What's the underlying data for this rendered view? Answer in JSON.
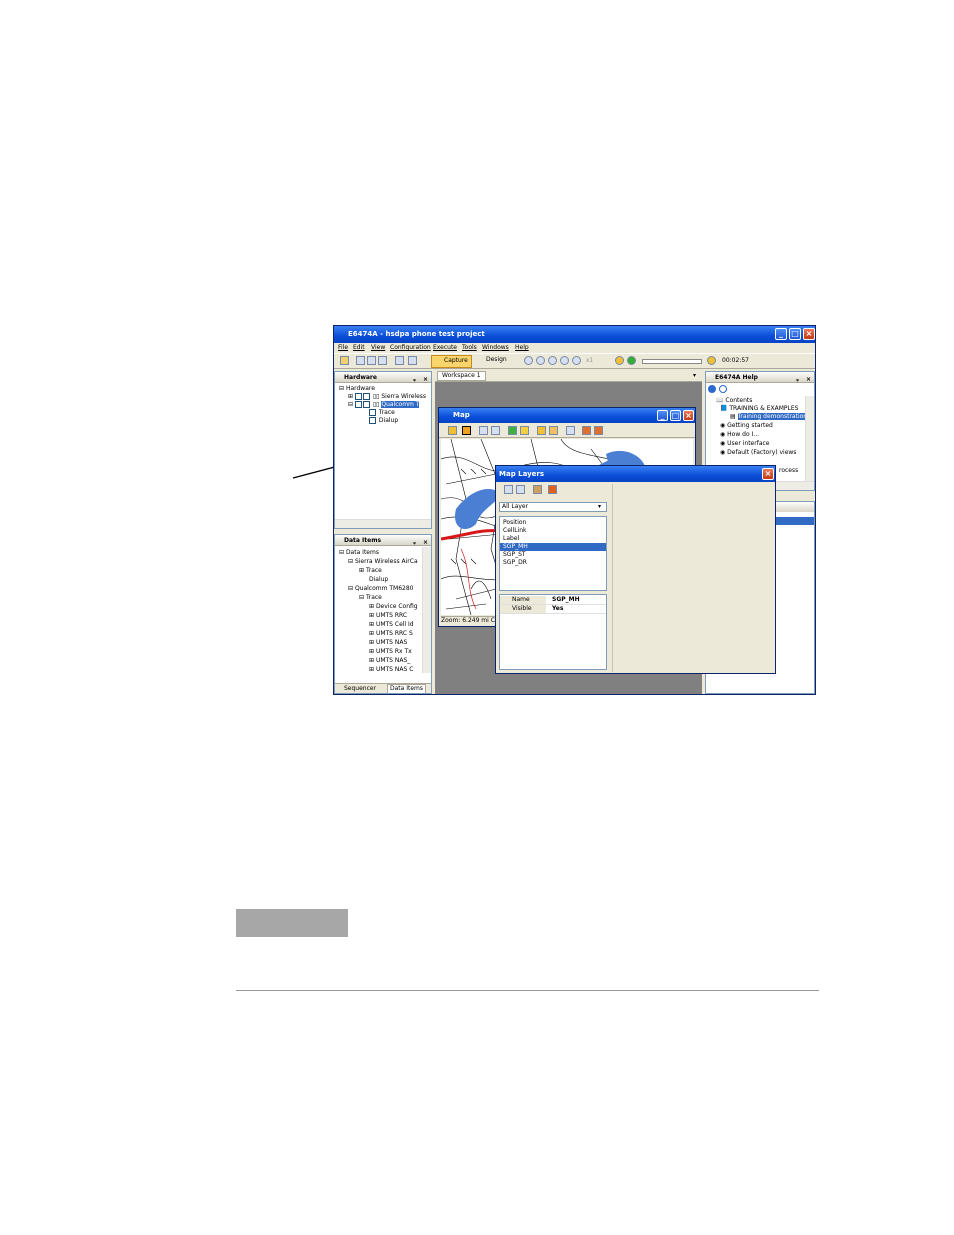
{
  "window": {
    "title": "E6474A - hsdpa phone test project"
  },
  "menu": [
    "File",
    "Edit",
    "View",
    "Configuration",
    "Execute",
    "Tools",
    "Windows",
    "Help"
  ],
  "toolbar": {
    "capture": "Capture",
    "design": "Design",
    "speed": "x1",
    "timer": "00:02:57"
  },
  "hardware": {
    "title": "Hardware",
    "root": "Hardware",
    "items": [
      "Sierra Wireless",
      "Qualcomm T",
      "Trace",
      "Dialup"
    ]
  },
  "dataitems": {
    "title": "Data Items",
    "items": [
      "Data Items",
      "Sierra Wireless AirCa",
      "Trace",
      "Dialup",
      "Qualcomm TM6280",
      "Trace",
      "Device Config",
      "UMTS RRC",
      "UMTS Cell Id",
      "UMTS RRC S",
      "UMTS NAS",
      "UMTS Rx Tx",
      "UMTS NAS_",
      "UMTS NAS C"
    ],
    "tabs": [
      "Sequencer",
      "Data Items"
    ]
  },
  "workspace": {
    "tab": "Workspace 1"
  },
  "map": {
    "title": "Map",
    "status": "Zoom: 6.249 mi Ce"
  },
  "help": {
    "title": "E6474A Help",
    "items": [
      "Contents",
      "TRAINING & EXAMPLES",
      "Training demonstration",
      "Getting started",
      "How do I...",
      "User interface",
      "Default (Factory) views",
      "rocess"
    ]
  },
  "layers": {
    "title": "Map Layers",
    "filter": "All Layer",
    "list": [
      "Position",
      "CellLink",
      "Label",
      "SGP_MH",
      "SGP_ST",
      "SGP_DR"
    ],
    "selected_index": 3,
    "props": [
      {
        "name": "Name",
        "value": "SGP_MH"
      },
      {
        "name": "Visible",
        "value": "Yes"
      }
    ]
  },
  "colors": {
    "titlebar": "#0a4ed8",
    "selection": "#316ac5",
    "road": "#d81818",
    "water": "#4a7fd4"
  }
}
